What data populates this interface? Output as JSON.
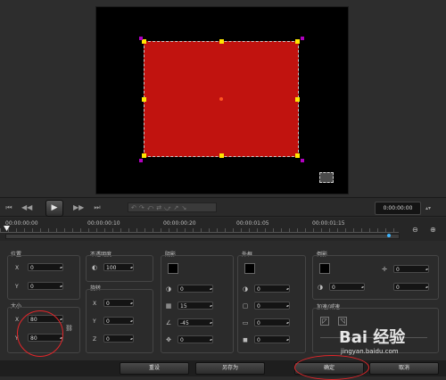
{
  "timecode": "0:00:00:00",
  "timeline": {
    "labels": [
      "00:00:00:00",
      "00:00:00:10",
      "00:00:00:20",
      "00:00:01:05",
      "00:00:01:15"
    ]
  },
  "panel": {
    "position": {
      "title": "位置",
      "x_label": "X",
      "x": "0",
      "y_label": "Y",
      "y": "0"
    },
    "size": {
      "title": "大小",
      "x_label": "X",
      "x": "80",
      "y_label": "Y",
      "y": "80"
    },
    "opacity": {
      "title": "不透明度",
      "value": "100"
    },
    "rotation": {
      "title": "旋转",
      "x_label": "X",
      "x": "0",
      "y_label": "Y",
      "y": "0",
      "z_label": "Z",
      "z": "0"
    },
    "shadow": {
      "title": "阴影",
      "v1": "0",
      "v2": "15",
      "v3": "-45",
      "v4": "0"
    },
    "border": {
      "title": "外框",
      "v1": "0",
      "v2": "0",
      "v3": "0",
      "v4": "0"
    },
    "reflection": {
      "title": "倒影",
      "v1": "0",
      "v2": "0",
      "v3": "0"
    },
    "ease": {
      "title": "加速/减速"
    }
  },
  "buttons": {
    "reset": "重设",
    "save_as": "另存为",
    "ok": "确定",
    "cancel": "取消"
  },
  "watermark": {
    "logo": "Bai 经验",
    "url": "jingyan.baidu.com"
  },
  "colors": {
    "overlay": "#c1130f",
    "handle": "#ffe600",
    "annotation": "#e3262a"
  }
}
